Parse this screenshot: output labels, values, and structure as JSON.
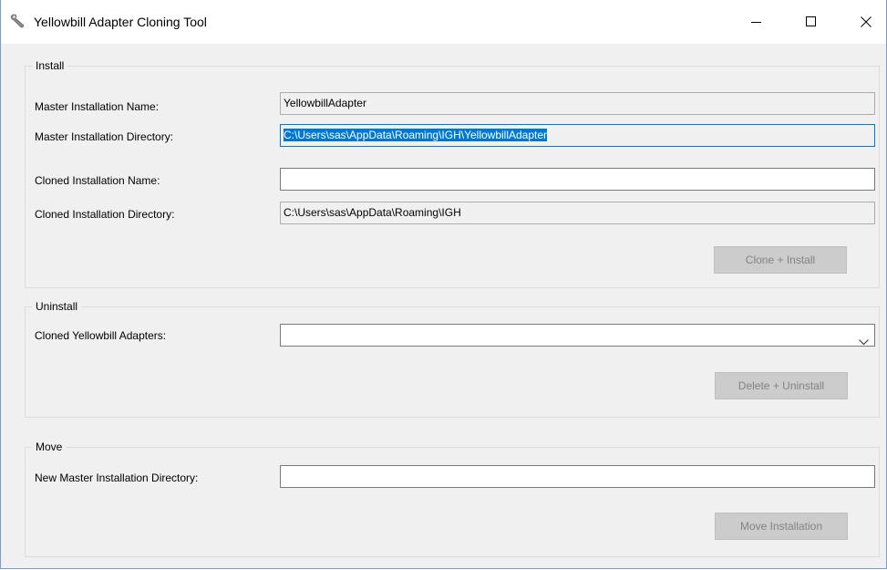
{
  "window": {
    "title": "Yellowbill Adapter Cloning Tool",
    "icon": "wrench-icon"
  },
  "install": {
    "group_title": "Install",
    "master_name_label": "Master Installation Name:",
    "master_name_value": "YellowbillAdapter",
    "master_dir_label": "Master Installation Directory:",
    "master_dir_value": "C:\\Users\\sas\\AppData\\Roaming\\IGH\\YellowbillAdapter",
    "cloned_name_label": "Cloned Installation Name:",
    "cloned_name_value": "",
    "cloned_dir_label": "Cloned Installation Directory:",
    "cloned_dir_value": "C:\\Users\\sas\\AppData\\Roaming\\IGH",
    "button_label": "Clone + Install"
  },
  "uninstall": {
    "group_title": "Uninstall",
    "adapters_label": "Cloned Yellowbill Adapters:",
    "adapters_selected": "",
    "button_label": "Delete + Uninstall"
  },
  "move": {
    "group_title": "Move",
    "new_dir_label": "New Master Installation Directory:",
    "new_dir_value": "",
    "button_label": "Move Installation"
  },
  "colors": {
    "selection": "#0078d7",
    "disabled_button_bg": "#cccccc",
    "disabled_button_text": "#838383",
    "window_bg": "#f0f0f0"
  }
}
